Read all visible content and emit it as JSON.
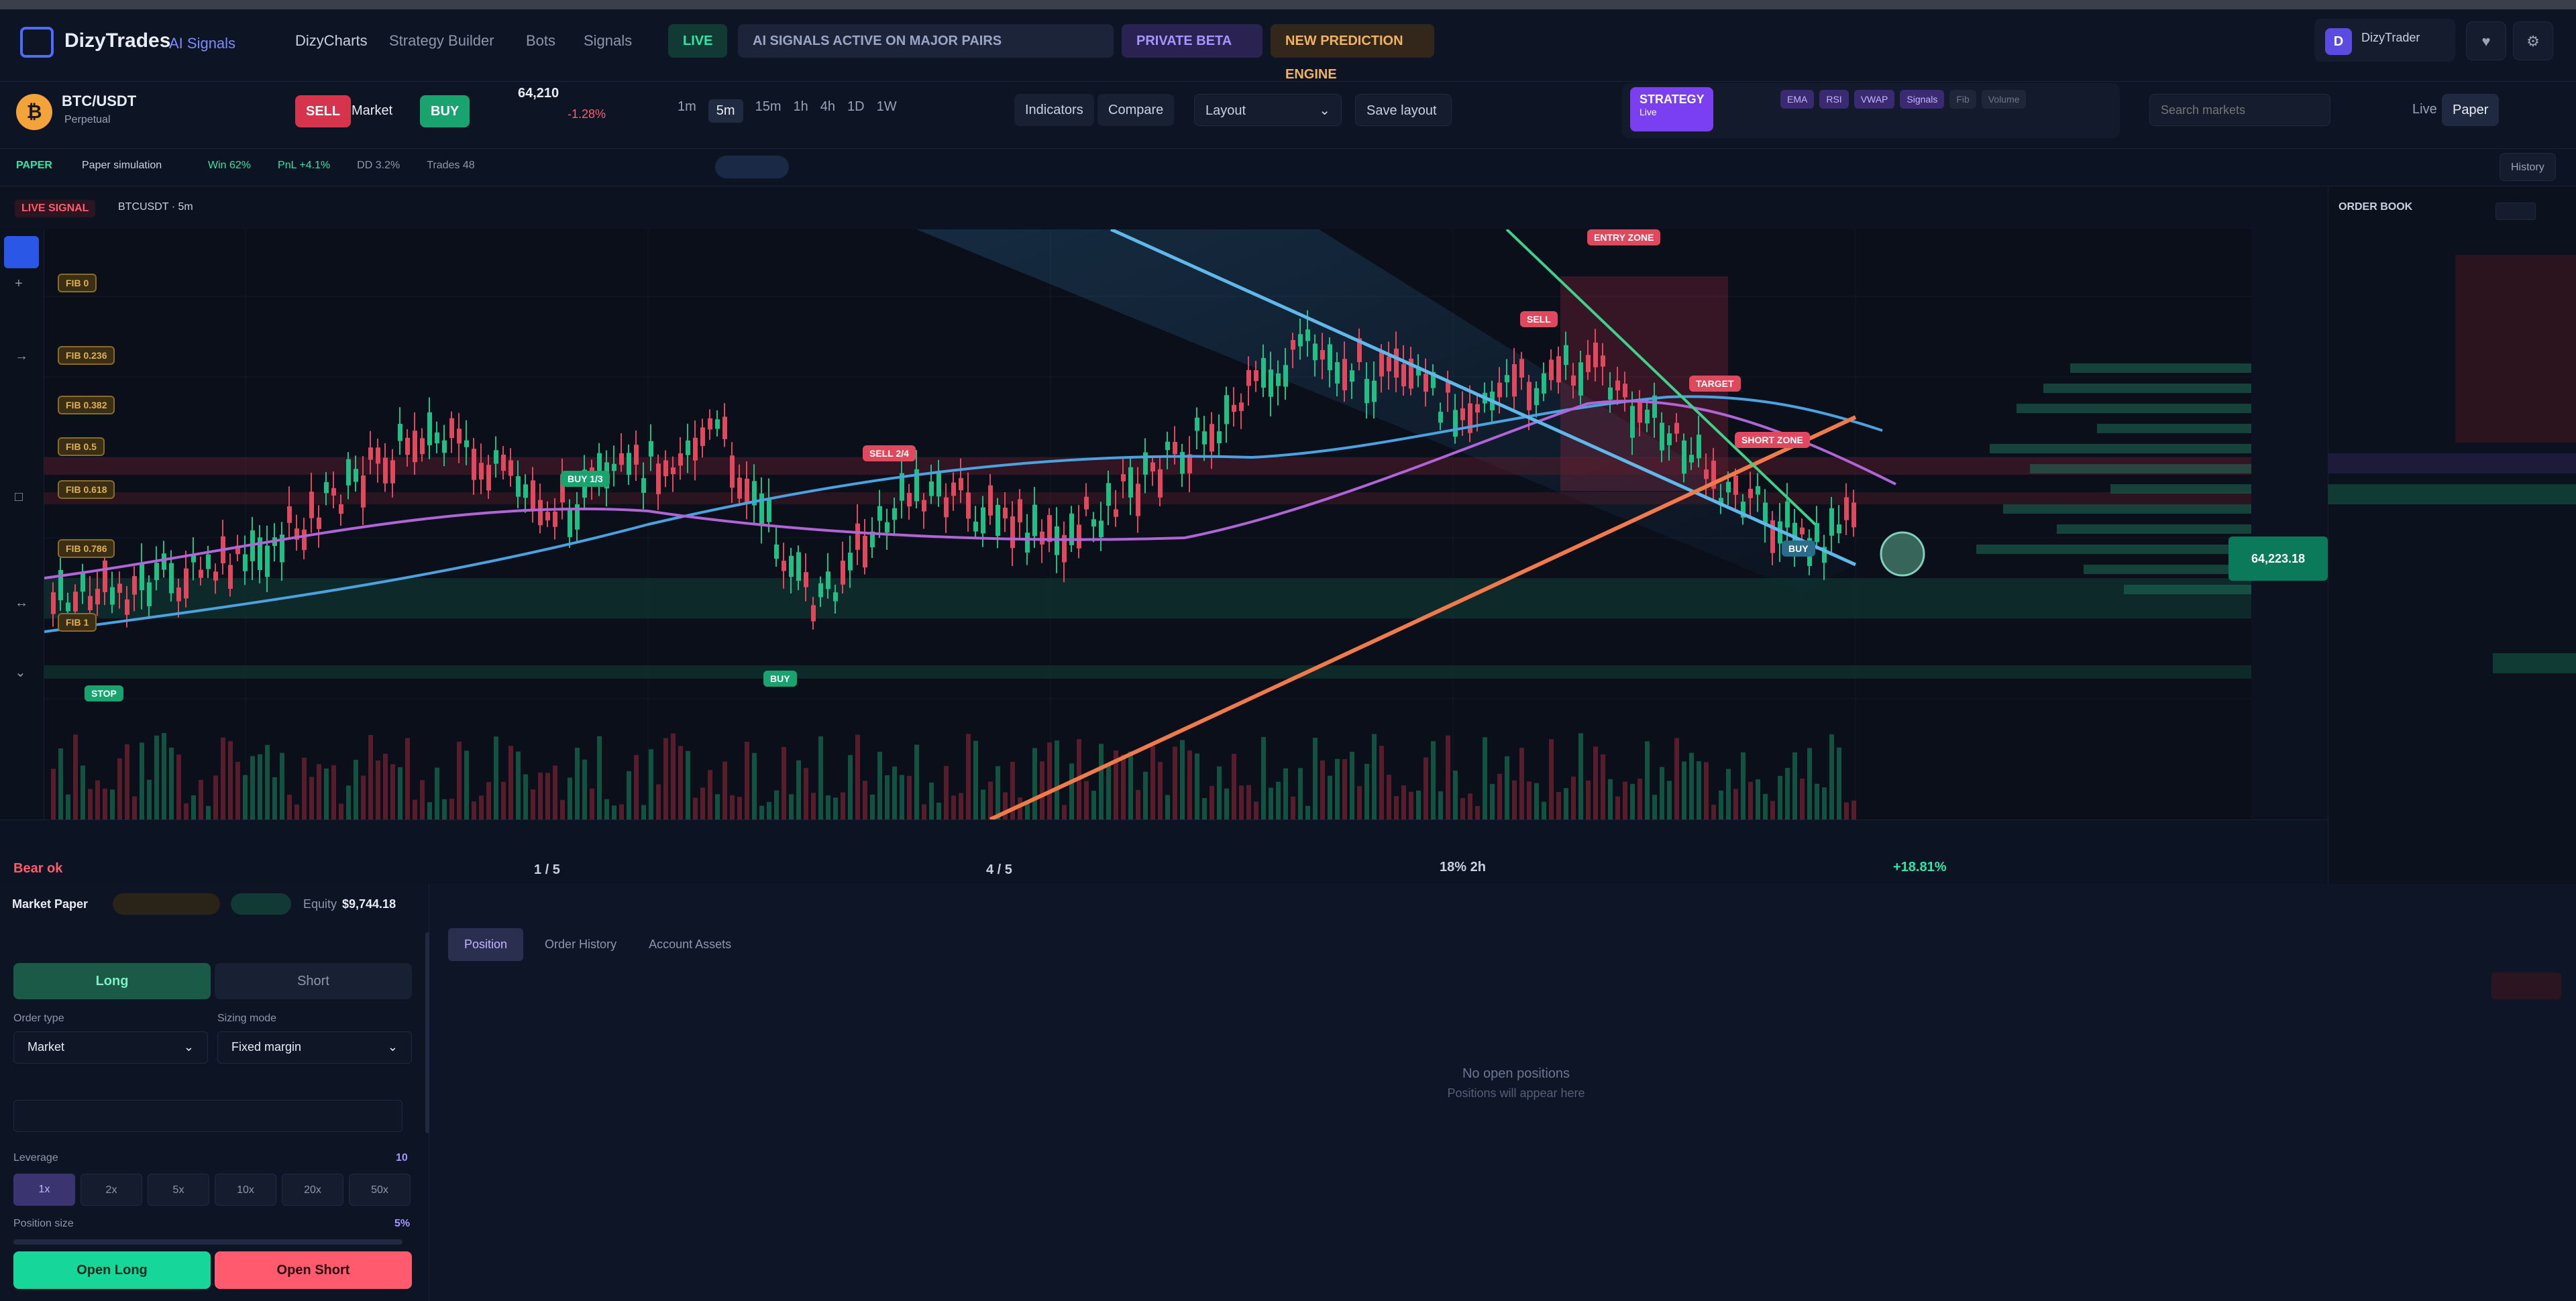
{
  "app": {
    "brand": "DizyTrades",
    "brand_sub": "AI Signals",
    "nav_links": [
      "DizyCharts",
      "Strategy Builder",
      "Bots",
      "Signals"
    ],
    "status_pill": "LIVE",
    "banner_1": "AI SIGNALS ACTIVE ON MAJOR PAIRS",
    "banner_2": "PRIVATE BETA",
    "banner_3": "NEW PREDICTION ENGINE"
  },
  "user": {
    "initial": "D",
    "name": "DizyTrader"
  },
  "toolbar": {
    "pair": "BTC/USDT",
    "pair_sub": "Perpetual",
    "sell_label": "SELL",
    "buy_label": "BUY",
    "mode_label": "Market",
    "price": "64,210",
    "change": "-1.28%",
    "timeframes": [
      "1m",
      "5m",
      "15m",
      "1h",
      "4h",
      "1D",
      "1W"
    ],
    "active_timeframe": "5m",
    "indicators_label": "Indicators",
    "compare_label": "Compare",
    "layout_label": "Layout",
    "save_label": "Save layout",
    "mode_switch": "STRATEGY",
    "mode_switch_sub": "Live",
    "chips": [
      "EMA",
      "RSI",
      "VWAP",
      "Signals",
      "Fib",
      "Volume"
    ],
    "search_placeholder": "Search markets",
    "paper_label": "Paper",
    "live_label": "Live"
  },
  "statrow": {
    "badge": "PAPER",
    "label": "Paper simulation",
    "stats": [
      "Win 62%",
      "PnL +4.1%",
      "DD 3.2%",
      "Trades 48"
    ],
    "history_label": "History"
  },
  "chart_header": {
    "live_badge": "LIVE SIGNAL",
    "title": "BTCUSDT · 5m"
  },
  "levels": {
    "left": [
      "FIB 0",
      "FIB 0.236",
      "FIB 0.382",
      "FIB 0.5",
      "FIB 0.618",
      "FIB 0.786",
      "FIB 1"
    ],
    "signals": [
      "SELL 2/4",
      "BUY 1/3",
      "BUY",
      "ENTRY ZONE",
      "SELL",
      "TARGET",
      "SHORT ZONE",
      "BUY",
      "STOP"
    ]
  },
  "orderbook": {
    "title": "ORDER BOOK",
    "mid_price": "64,223.18"
  },
  "bottom": {
    "stat_1_value": "Bear ok",
    "stat_2_value": "1 / 5",
    "stat_3_value": "4 / 5",
    "stat_4_value": "18% 2h",
    "stat_5_value": "+18.81%"
  },
  "trade": {
    "title": "Market Paper",
    "balance_label": "Equity",
    "balance": "$9,744.18",
    "long_tab": "Long",
    "short_tab": "Short",
    "order_type_label": "Order type",
    "order_type": "Market",
    "size_mode_label": "Sizing mode",
    "size_mode": "Fixed margin",
    "leverage_label": "Leverage",
    "leverage_value": "10",
    "leverage_options": [
      "1x",
      "2x",
      "5x",
      "10x",
      "20x",
      "50x"
    ],
    "position_label": "Position size",
    "position_value": "5%",
    "open_long": "Open Long",
    "open_short": "Open Short"
  },
  "positions": {
    "tabs": [
      "Position",
      "Order History",
      "Account Assets"
    ],
    "empty_title": "No open positions",
    "empty_sub": "Positions will appear here"
  }
}
